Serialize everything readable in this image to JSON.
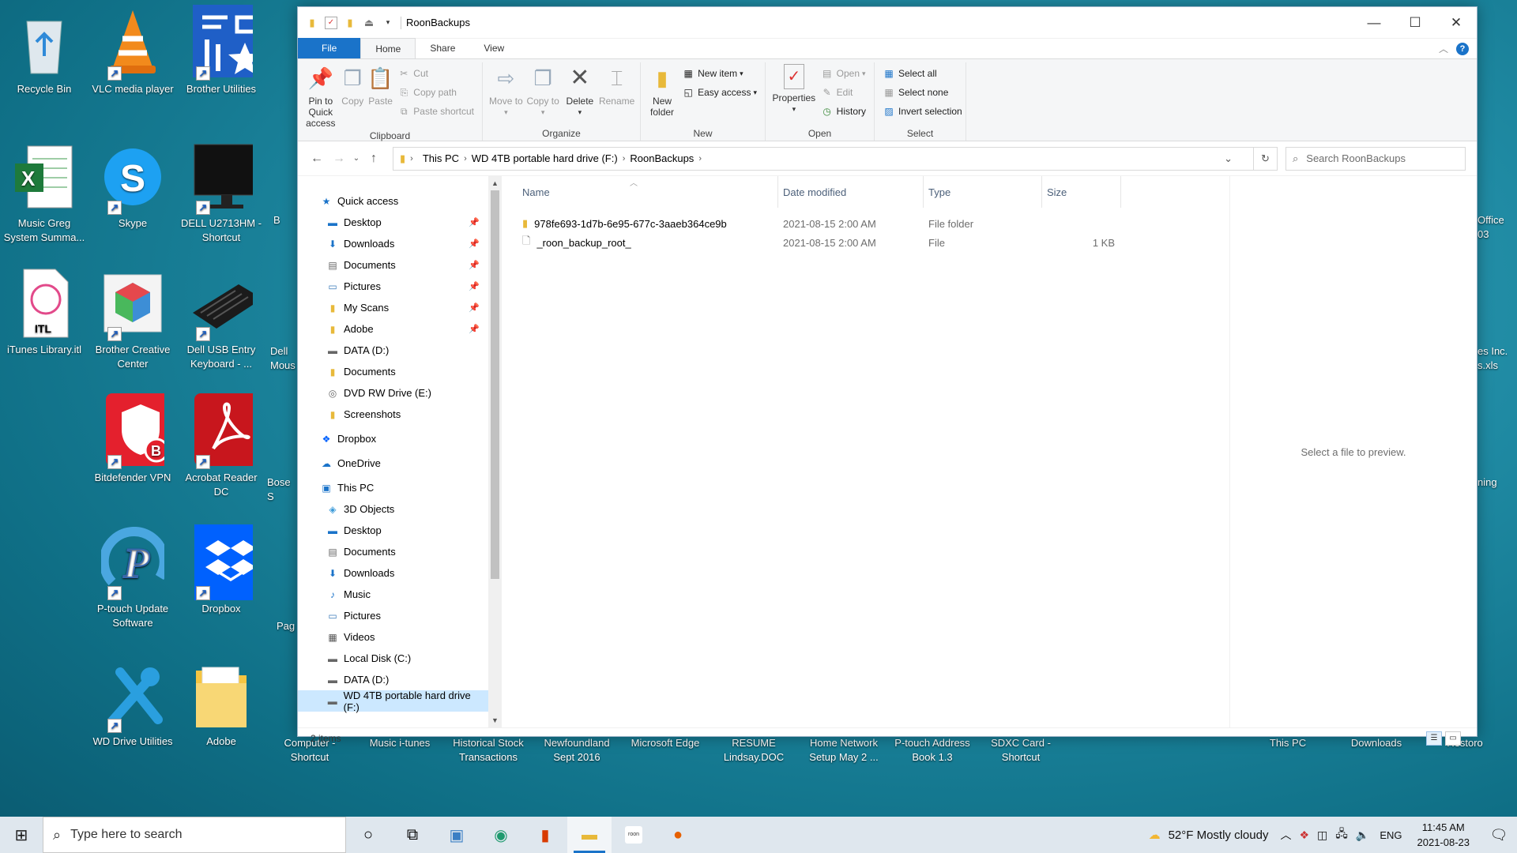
{
  "desktop": {
    "icons": [
      {
        "label": "Recycle Bin",
        "icon": "recycle-bin-icon"
      },
      {
        "label": "VLC media player",
        "icon": "vlc-icon"
      },
      {
        "label": "Brother Utilities",
        "icon": "brother-utilities-icon"
      },
      {
        "label": "Music Greg System Summa...",
        "icon": "excel-icon"
      },
      {
        "label": "Skype",
        "icon": "skype-icon"
      },
      {
        "label": "DELL U2713HM - Shortcut",
        "icon": "monitor-icon"
      },
      {
        "label": "iTunes Library.itl",
        "icon": "itunes-file-icon"
      },
      {
        "label": "Brother Creative Center",
        "icon": "brother-creative-icon"
      },
      {
        "label": "Dell USB Entry Keyboard - ...",
        "icon": "keyboard-icon"
      },
      {
        "label": "Bitdefender VPN",
        "icon": "bitdefender-icon"
      },
      {
        "label": "Acrobat Reader DC",
        "icon": "acrobat-icon"
      },
      {
        "label": "P-touch Update Software",
        "icon": "ptouch-icon"
      },
      {
        "label": "Dropbox",
        "icon": "dropbox-icon"
      },
      {
        "label": "WD Drive Utilities",
        "icon": "tools-icon"
      },
      {
        "label": "Adobe",
        "icon": "folder-icon"
      }
    ],
    "partial_labels": [
      "B",
      "Dell Mous",
      "Bose S",
      "Pag",
      "Office 03",
      "es Inc. s.xls",
      "ning"
    ],
    "bottom_labels": [
      "Computer - Shortcut",
      "Music i-tunes",
      "Historical Stock Transactions",
      "Newfoundland Sept 2016",
      "Microsoft Edge",
      "RESUME Lindsay.DOC",
      "Home Network Setup May 2 ...",
      "P-touch Address Book 1.3",
      "SDXC Card - Shortcut",
      "This PC",
      "Downloads",
      "Restoro"
    ]
  },
  "window": {
    "title": "RoonBackups",
    "tabs": [
      "File",
      "Home",
      "Share",
      "View"
    ],
    "ribbon": {
      "clipboard": {
        "label": "Clipboard",
        "pin": "Pin to Quick access",
        "copy": "Copy",
        "paste": "Paste",
        "cut": "Cut",
        "copy_path": "Copy path",
        "paste_shortcut": "Paste shortcut"
      },
      "organize": {
        "label": "Organize",
        "move_to": "Move to",
        "copy_to": "Copy to",
        "delete": "Delete",
        "rename": "Rename"
      },
      "new": {
        "label": "New",
        "new_folder": "New folder",
        "new_item": "New item",
        "easy_access": "Easy access"
      },
      "open": {
        "label": "Open",
        "properties": "Properties",
        "open": "Open",
        "edit": "Edit",
        "history": "History"
      },
      "select": {
        "label": "Select",
        "select_all": "Select all",
        "select_none": "Select none",
        "invert": "Invert selection"
      }
    },
    "address": {
      "crumbs": [
        "This PC",
        "WD 4TB portable hard drive (F:)",
        "RoonBackups"
      ],
      "search_placeholder": "Search RoonBackups"
    },
    "nav": [
      {
        "label": "Quick access",
        "icon": "star-icon",
        "level": 1,
        "pinned": false
      },
      {
        "label": "Desktop",
        "icon": "desktop-icon",
        "level": 2,
        "pinned": true
      },
      {
        "label": "Downloads",
        "icon": "download-icon",
        "level": 2,
        "pinned": true
      },
      {
        "label": "Documents",
        "icon": "documents-icon",
        "level": 2,
        "pinned": true
      },
      {
        "label": "Pictures",
        "icon": "pictures-icon",
        "level": 2,
        "pinned": true
      },
      {
        "label": "My Scans",
        "icon": "folder-icon",
        "level": 2,
        "pinned": true
      },
      {
        "label": "Adobe",
        "icon": "folder-icon",
        "level": 2,
        "pinned": true
      },
      {
        "label": "DATA (D:)",
        "icon": "drive-icon",
        "level": 2,
        "pinned": false
      },
      {
        "label": "Documents",
        "icon": "folder-icon",
        "level": 2,
        "pinned": false
      },
      {
        "label": "DVD RW Drive (E:)",
        "icon": "dvd-icon",
        "level": 2,
        "pinned": false
      },
      {
        "label": "Screenshots",
        "icon": "folder-icon",
        "level": 2,
        "pinned": false
      },
      {
        "label": "Dropbox",
        "icon": "dropbox-icon",
        "level": 1,
        "pinned": false
      },
      {
        "label": "OneDrive",
        "icon": "cloud-icon",
        "level": 1,
        "pinned": false
      },
      {
        "label": "This PC",
        "icon": "computer-icon",
        "level": 1,
        "pinned": false
      },
      {
        "label": "3D Objects",
        "icon": "cube-icon",
        "level": 2,
        "pinned": false
      },
      {
        "label": "Desktop",
        "icon": "desktop-icon",
        "level": 2,
        "pinned": false
      },
      {
        "label": "Documents",
        "icon": "documents-icon",
        "level": 2,
        "pinned": false
      },
      {
        "label": "Downloads",
        "icon": "download-icon",
        "level": 2,
        "pinned": false
      },
      {
        "label": "Music",
        "icon": "music-icon",
        "level": 2,
        "pinned": false
      },
      {
        "label": "Pictures",
        "icon": "pictures-icon",
        "level": 2,
        "pinned": false
      },
      {
        "label": "Videos",
        "icon": "video-icon",
        "level": 2,
        "pinned": false
      },
      {
        "label": "Local Disk (C:)",
        "icon": "drive-icon",
        "level": 2,
        "pinned": false
      },
      {
        "label": "DATA (D:)",
        "icon": "drive-icon",
        "level": 2,
        "pinned": false
      },
      {
        "label": "WD 4TB portable hard drive (F:)",
        "icon": "drive-icon",
        "level": 2,
        "pinned": false,
        "selected": true
      }
    ],
    "columns": [
      "Name",
      "Date modified",
      "Type",
      "Size"
    ],
    "files": [
      {
        "name": "978fe693-1d7b-6e95-677c-3aaeb364ce9b",
        "date": "2021-08-15 2:00 AM",
        "type": "File folder",
        "size": "",
        "icon": "folder-icon"
      },
      {
        "name": "_roon_backup_root_",
        "date": "2021-08-15 2:00 AM",
        "type": "File",
        "size": "1 KB",
        "icon": "file-icon"
      }
    ],
    "preview_text": "Select a file to preview.",
    "status": "2 items"
  },
  "taskbar": {
    "search_placeholder": "Type here to search",
    "weather": "52°F  Mostly cloudy",
    "lang": "ENG",
    "time": "11:45 AM",
    "date": "2021-08-23"
  }
}
